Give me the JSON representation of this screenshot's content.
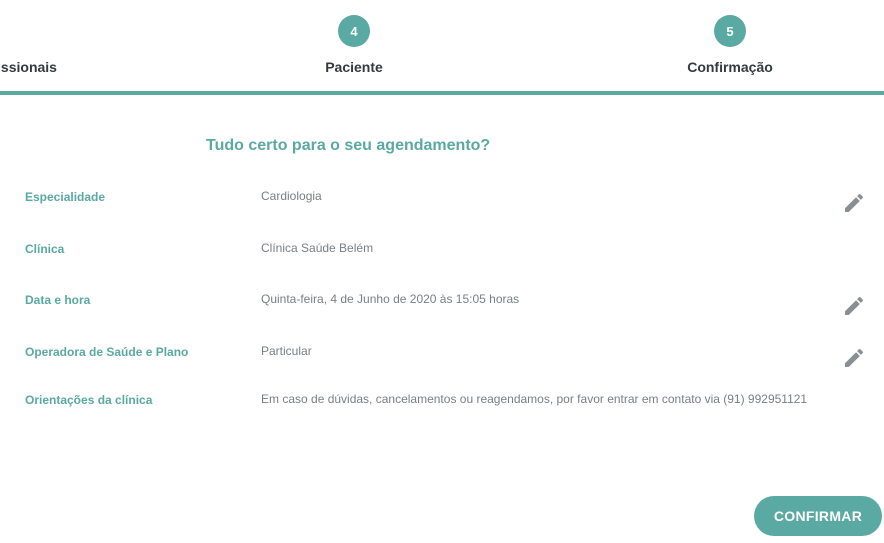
{
  "stepper": {
    "steps": [
      {
        "label": "issionais"
      },
      {
        "number": "4",
        "label": "Paciente"
      },
      {
        "number": "5",
        "label": "Confirmação"
      }
    ]
  },
  "summary": {
    "title": "Tudo certo para o seu agendamento?",
    "rows": [
      {
        "label": "Especialidade",
        "value": "Cardiologia",
        "editable": true
      },
      {
        "label": "Clínica",
        "value": "Clínica Saúde Belém",
        "editable": false
      },
      {
        "label": "Data e hora",
        "value": "Quinta-feira, 4 de Junho de 2020 às 15:05 horas",
        "editable": true
      },
      {
        "label": "Operadora de Saúde e Plano",
        "value": "Particular",
        "editable": true
      },
      {
        "label": "Orientações da clínica",
        "value": "Em caso de dúvidas, cancelamentos ou reagendamos, por favor entrar em contato via (91) 992951121",
        "editable": false
      }
    ]
  },
  "actions": {
    "confirm_label": "CONFIRMAR"
  },
  "icons": {
    "edit": "pencil-icon"
  },
  "colors": {
    "accent": "#5aa9a2",
    "value_text": "#7a7f84",
    "label_dark": "#333a40",
    "icon": "#8a8f94"
  }
}
